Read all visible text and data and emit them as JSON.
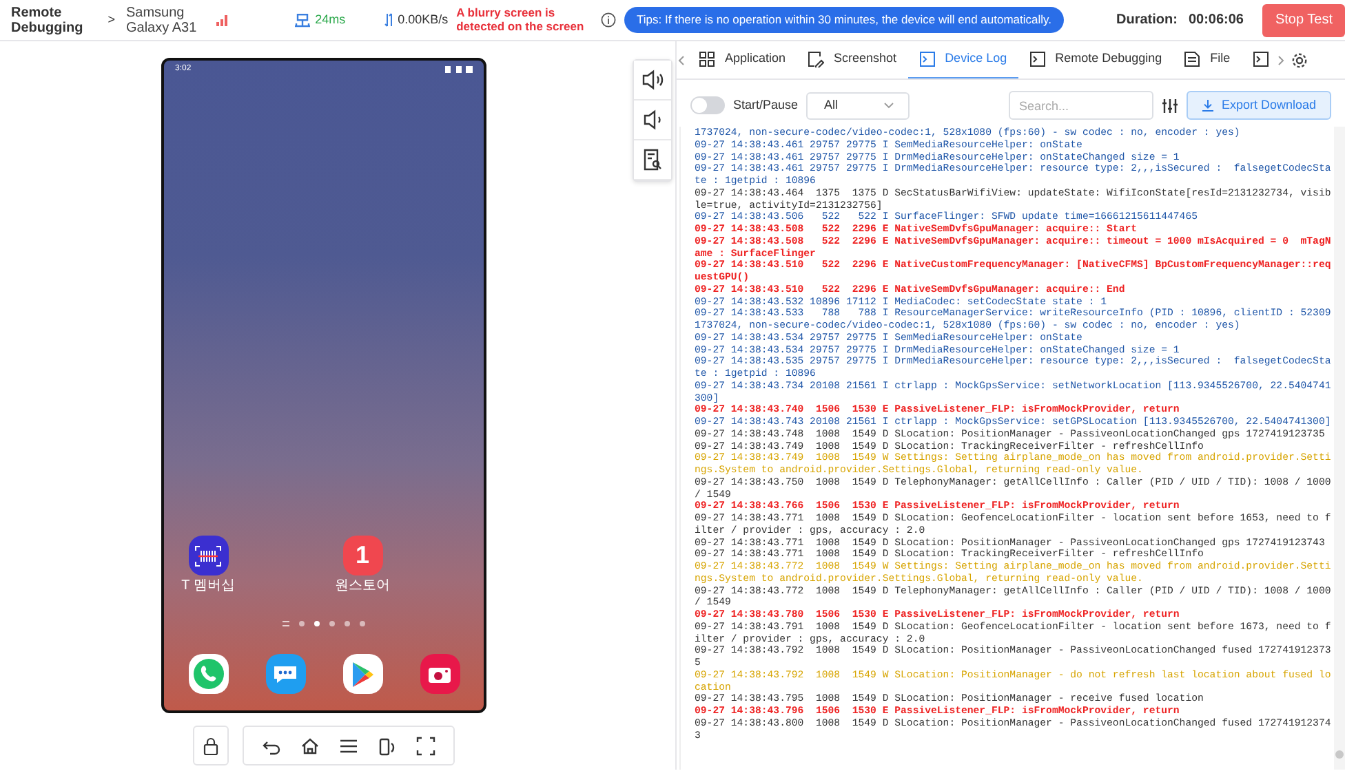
{
  "header": {
    "title": "Remote Debugging",
    "separator": ">",
    "device": "Samsung Galaxy A31",
    "latency": "24ms",
    "speed": "0.00KB/s",
    "warning": "A blurry screen is detected on the screen",
    "tip": "Tips: If there is no operation within 30 minutes, the device will end automatically.",
    "duration_label": "Duration:",
    "duration": "00:06:06",
    "stop_button": "Stop Test"
  },
  "phone": {
    "status_time": "3:02",
    "apps": [
      {
        "kind": "barcode",
        "label": "T 멤버십",
        "color": "#3b2fd0"
      },
      {
        "kind": "store",
        "label": "원스토어",
        "color": "#f0474f",
        "icon_text": "1"
      }
    ],
    "pages": [
      {
        "kind": "menu",
        "selected": false
      },
      {
        "kind": "dot",
        "selected": false
      },
      {
        "kind": "dot",
        "selected": true
      },
      {
        "kind": "dot",
        "selected": false
      },
      {
        "kind": "dot",
        "selected": false
      },
      {
        "kind": "dot",
        "selected": false
      }
    ]
  },
  "tabs": [
    {
      "kind": "grid",
      "label": "Application",
      "selected": false
    },
    {
      "kind": "screenshot",
      "label": "Screenshot",
      "selected": false
    },
    {
      "kind": "terminal",
      "label": "Device Log",
      "selected": true
    },
    {
      "kind": "terminal",
      "label": "Remote Debugging",
      "selected": false
    },
    {
      "kind": "file",
      "label": "File",
      "selected": false
    },
    {
      "kind": "terminal",
      "selected": false
    }
  ],
  "toolbar": {
    "toggle_label": "Start/Pause",
    "on": false,
    "filter_value": "All",
    "search_placeholder": "Search...",
    "export_button": "Export Download"
  },
  "log": [
    {
      "kind": "info",
      "text": "1737024, non-secure-codec/video-codec:1, 528x1080 (fps:60) - sw codec : no, encoder : yes)"
    },
    {
      "kind": "info",
      "text": "09-27 14:38:43.461 29757 29775 I SemMediaResourceHelper: onState"
    },
    {
      "kind": "info",
      "text": "09-27 14:38:43.461 29757 29775 I DrmMediaResourceHelper: onStateChanged size = 1"
    },
    {
      "kind": "info",
      "text": "09-27 14:38:43.461 29757 29775 I DrmMediaResourceHelper: resource type: 2,,,isSecured :  falsegetCodecState : 1getpid : 10896"
    },
    {
      "kind": "debug",
      "text": "09-27 14:38:43.464  1375  1375 D SecStatusBarWifiView: updateState: WifiIconState[resId=2131232734, visible=true, activityId=2131232756]"
    },
    {
      "kind": "info",
      "text": "09-27 14:38:43.506   522   522 I SurfaceFlinger: SFWD update time=16661215611447465"
    },
    {
      "kind": "error",
      "text": "09-27 14:38:43.508   522  2296 E NativeSemDvfsGpuManager: acquire:: Start"
    },
    {
      "kind": "error",
      "text": "09-27 14:38:43.508   522  2296 E NativeSemDvfsGpuManager: acquire:: timeout = 1000 mIsAcquired = 0  mTagName : SurfaceFlinger"
    },
    {
      "kind": "error",
      "text": "09-27 14:38:43.510   522  2296 E NativeCustomFrequencyManager: [NativeCFMS] BpCustomFrequencyManager::requestGPU()"
    },
    {
      "kind": "error",
      "text": "09-27 14:38:43.510   522  2296 E NativeSemDvfsGpuManager: acquire:: End"
    },
    {
      "kind": "info",
      "text": "09-27 14:38:43.532 10896 17112 I MediaCodec: setCodecState state : 1"
    },
    {
      "kind": "info",
      "text": "09-27 14:38:43.533   788   788 I ResourceManagerService: writeResourceInfo (PID : 10896, clientID : 523091737024, non-secure-codec/video-codec:1, 528x1080 (fps:60) - sw codec : no, encoder : yes)"
    },
    {
      "kind": "info",
      "text": "09-27 14:38:43.534 29757 29775 I SemMediaResourceHelper: onState"
    },
    {
      "kind": "info",
      "text": "09-27 14:38:43.534 29757 29775 I DrmMediaResourceHelper: onStateChanged size = 1"
    },
    {
      "kind": "info",
      "text": "09-27 14:38:43.535 29757 29775 I DrmMediaResourceHelper: resource type: 2,,,isSecured :  falsegetCodecState : 1getpid : 10896"
    },
    {
      "kind": "info",
      "text": "09-27 14:38:43.734 20108 21561 I ctrlapp : MockGpsService: setNetworkLocation [113.9345526700, 22.5404741300]"
    },
    {
      "kind": "error",
      "text": "09-27 14:38:43.740  1506  1530 E PassiveListener_FLP: isFromMockProvider, return"
    },
    {
      "kind": "info",
      "text": "09-27 14:38:43.743 20108 21561 I ctrlapp : MockGpsService: setGPSLocation [113.9345526700, 22.5404741300]"
    },
    {
      "kind": "debug",
      "text": "09-27 14:38:43.748  1008  1549 D SLocation: PositionManager - PassiveonLocationChanged gps 1727419123735"
    },
    {
      "kind": "debug",
      "text": "09-27 14:38:43.749  1008  1549 D SLocation: TrackingReceiverFilter - refreshCellInfo"
    },
    {
      "kind": "warn",
      "text": "09-27 14:38:43.749  1008  1549 W Settings: Setting airplane_mode_on has moved from android.provider.Settings.System to android.provider.Settings.Global, returning read-only value."
    },
    {
      "kind": "debug",
      "text": "09-27 14:38:43.750  1008  1549 D TelephonyManager: getAllCellInfo : Caller (PID / UID / TID): 1008 / 1000 / 1549"
    },
    {
      "kind": "error",
      "text": "09-27 14:38:43.766  1506  1530 E PassiveListener_FLP: isFromMockProvider, return"
    },
    {
      "kind": "debug",
      "text": "09-27 14:38:43.771  1008  1549 D SLocation: GeofenceLocationFilter - location sent before 1653, need to filter / provider : gps, accuracy : 2.0"
    },
    {
      "kind": "debug",
      "text": "09-27 14:38:43.771  1008  1549 D SLocation: PositionManager - PassiveonLocationChanged gps 1727419123743"
    },
    {
      "kind": "debug",
      "text": "09-27 14:38:43.771  1008  1549 D SLocation: TrackingReceiverFilter - refreshCellInfo"
    },
    {
      "kind": "warn",
      "text": "09-27 14:38:43.772  1008  1549 W Settings: Setting airplane_mode_on has moved from android.provider.Settings.System to android.provider.Settings.Global, returning read-only value."
    },
    {
      "kind": "debug",
      "text": "09-27 14:38:43.772  1008  1549 D TelephonyManager: getAllCellInfo : Caller (PID / UID / TID): 1008 / 1000 / 1549"
    },
    {
      "kind": "error",
      "text": "09-27 14:38:43.780  1506  1530 E PassiveListener_FLP: isFromMockProvider, return"
    },
    {
      "kind": "debug",
      "text": "09-27 14:38:43.791  1008  1549 D SLocation: GeofenceLocationFilter - location sent before 1673, need to filter / provider : gps, accuracy : 2.0"
    },
    {
      "kind": "debug",
      "text": "09-27 14:38:43.792  1008  1549 D SLocation: PositionManager - PassiveonLocationChanged fused 1727419123735"
    },
    {
      "kind": "warn",
      "text": "09-27 14:38:43.792  1008  1549 W SLocation: PositionManager - do not refresh last location about fused location"
    },
    {
      "kind": "debug",
      "text": "09-27 14:38:43.795  1008  1549 D SLocation: PositionManager - receive fused location"
    },
    {
      "kind": "error",
      "text": "09-27 14:38:43.796  1506  1530 E PassiveListener_FLP: isFromMockProvider, return"
    },
    {
      "kind": "debug",
      "text": "09-27 14:38:43.800  1008  1549 D SLocation: PositionManager - PassiveonLocationChanged fused 1727419123743"
    }
  ]
}
